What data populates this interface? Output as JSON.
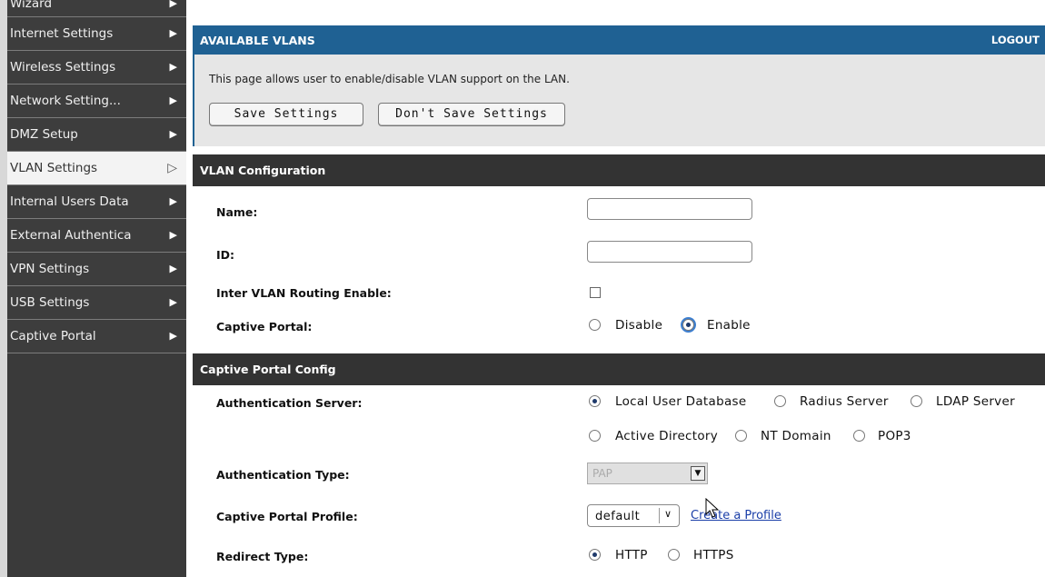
{
  "sidebar": {
    "items": [
      {
        "label": "Wizard"
      },
      {
        "label": "Internet Settings"
      },
      {
        "label": "Wireless Settings"
      },
      {
        "label": "Network Setting..."
      },
      {
        "label": "DMZ Setup"
      },
      {
        "label": "VLAN Settings"
      },
      {
        "label": "Internal Users Data"
      },
      {
        "label": "External Authentica"
      },
      {
        "label": "VPN Settings"
      },
      {
        "label": "USB Settings"
      },
      {
        "label": "Captive Portal"
      }
    ]
  },
  "header": {
    "title": "AVAILABLE VLANS",
    "logout": "LOGOUT"
  },
  "info": {
    "description": "This page allows user to enable/disable VLAN support on the LAN.",
    "save_label": "Save Settings",
    "dont_save_label": "Don't Save Settings"
  },
  "vlan_config": {
    "title": "VLAN Configuration",
    "name_label": "Name:",
    "name_value": "",
    "id_label": "ID:",
    "id_value": "",
    "routing_label": "Inter VLAN Routing Enable:",
    "routing_checked": false,
    "captive_label": "Captive Portal:",
    "captive_options": [
      "Disable",
      "Enable"
    ],
    "captive_selected": "Enable"
  },
  "captive_config": {
    "title": "Captive Portal Config",
    "auth_server_label": "Authentication Server:",
    "auth_server_options": [
      "Local User Database",
      "Radius Server",
      "LDAP Server",
      "Active Directory",
      "NT Domain",
      "POP3"
    ],
    "auth_server_selected": "Local User Database",
    "auth_type_label": "Authentication Type:",
    "auth_type_value": "PAP",
    "profile_label": "Captive Portal Profile:",
    "profile_value": "default",
    "create_profile_link": "Create a Profile",
    "redirect_label": "Redirect Type:",
    "redirect_options": [
      "HTTP",
      "HTTPS"
    ],
    "redirect_selected": "HTTP"
  },
  "colors": {
    "header_blue": "#1f6193",
    "section_dark": "#333333",
    "sidebar_dark": "#3d3d3d",
    "link_blue": "#1a3ea8"
  }
}
